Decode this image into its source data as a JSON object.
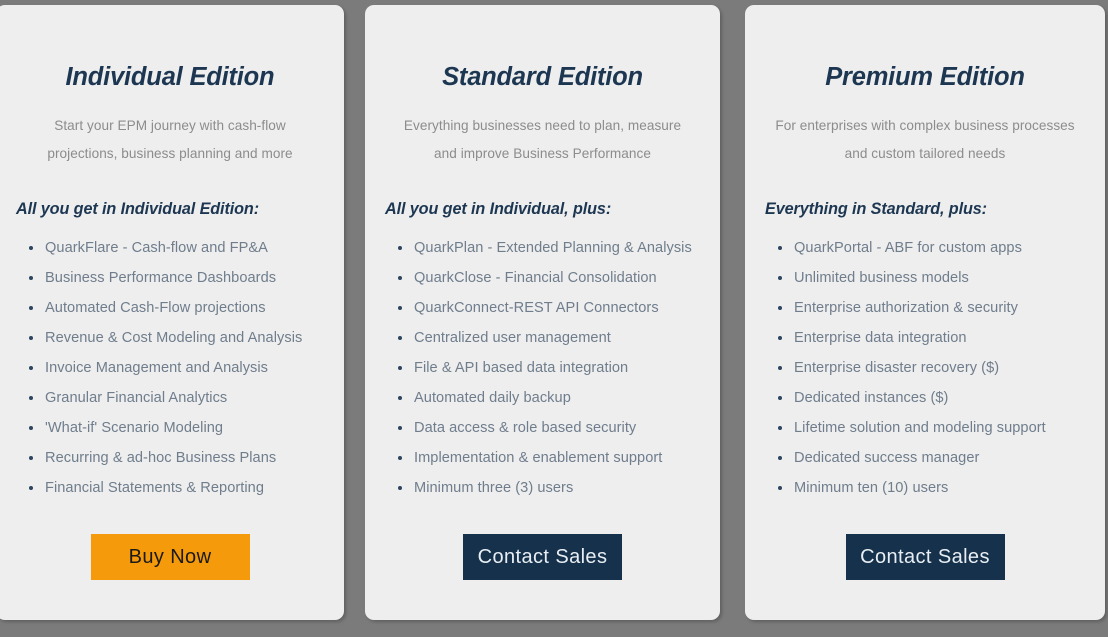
{
  "theme": {
    "page_background": "#7b7b7b",
    "card_background": "#eeeeee",
    "heading_color": "#1d3752",
    "body_text_color": "#6f7d8c",
    "subtitle_color": "#8c8c8c",
    "accent_orange": "#f59b0b",
    "accent_navy": "#15314b"
  },
  "plans": [
    {
      "title": "Individual Edition",
      "subtitle": "Start your EPM journey with cash-flow projections, business planning and more",
      "features_heading": "All you get in Individual Edition:",
      "features": [
        "QuarkFlare - Cash-flow and FP&A",
        "Business Performance Dashboards",
        "Automated Cash-Flow projections",
        "Revenue & Cost Modeling and Analysis",
        "Invoice Management and Analysis",
        "Granular Financial Analytics",
        "'What-if' Scenario Modeling",
        "Recurring & ad-hoc Business Plans",
        "Financial Statements & Reporting"
      ],
      "cta_label": "Buy Now"
    },
    {
      "title": "Standard Edition",
      "subtitle": "Everything businesses need to plan, measure and improve Business Performance",
      "features_heading": "All you get in Individual, plus:",
      "features": [
        "QuarkPlan - Extended Planning & Analysis",
        "QuarkClose - Financial Consolidation",
        "QuarkConnect-REST API Connectors",
        "Centralized user management",
        "File & API based data integration",
        "Automated daily backup",
        "Data access & role based security",
        "Implementation & enablement support",
        "Minimum three (3) users"
      ],
      "cta_label": "Contact Sales"
    },
    {
      "title": "Premium Edition",
      "subtitle": "For enterprises with complex business processes and custom tailored needs",
      "features_heading": "Everything in Standard, plus:",
      "features": [
        "QuarkPortal - ABF for custom apps",
        "Unlimited business models",
        "Enterprise authorization & security",
        "Enterprise data integration",
        "Enterprise disaster recovery ($)",
        "Dedicated instances ($)",
        "Lifetime solution and modeling support",
        "Dedicated success manager",
        "Minimum ten (10) users"
      ],
      "cta_label": "Contact Sales"
    }
  ]
}
